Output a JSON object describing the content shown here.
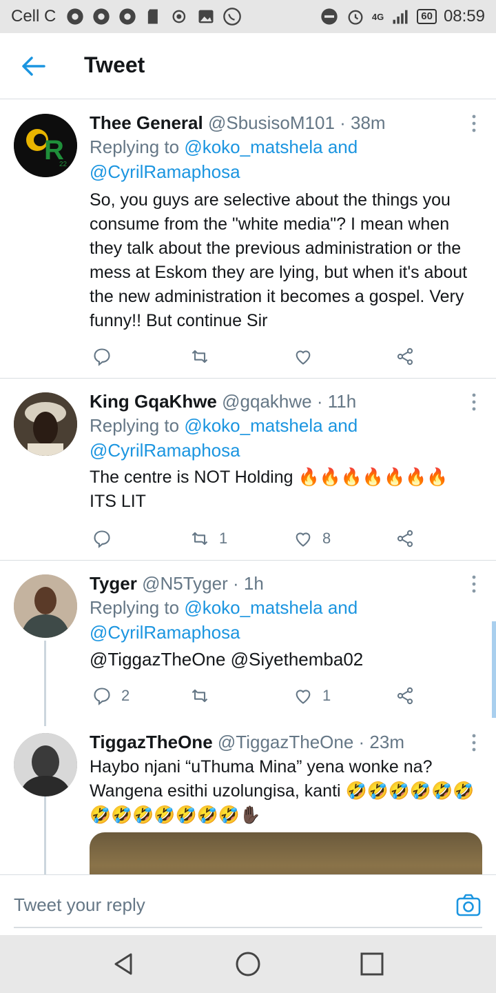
{
  "status_bar": {
    "carrier": "Cell C",
    "network": "4G",
    "battery": "60",
    "time": "08:59",
    "colors": {
      "bg": "#e6e6e6"
    }
  },
  "header": {
    "title": "Tweet"
  },
  "tweets": [
    {
      "name": "Thee General",
      "handle": "@SbusisoM101 · 38m",
      "replying_prefix": "Replying to ",
      "replying_user1": "@koko_matshela",
      "replying_and": " and",
      "replying_user2": "@CyrilRamaphosa",
      "text": "So, you guys are selective about the things you consume from the \"white media\"? I mean when they talk about the previous administration or the mess at Eskom they are lying, but when it's about the new administration it becomes a gospel. Very funny!! But continue Sir",
      "avatar_text": "R",
      "avatar_sub": "22",
      "replies": "",
      "retweets": "",
      "likes": ""
    },
    {
      "name": "King GqaKhwe",
      "handle": "@gqakhwe · 11h",
      "replying_prefix": "Replying to ",
      "replying_user1": "@koko_matshela",
      "replying_and": " and",
      "replying_user2": "@CyrilRamaphosa",
      "text": "The centre is NOT Holding 🔥🔥🔥🔥🔥🔥🔥 ITS LIT",
      "replies": "",
      "retweets": "1",
      "likes": "8"
    },
    {
      "name": "Tyger",
      "handle": "@N5Tyger · 1h",
      "replying_prefix": "Replying to ",
      "replying_user1": "@koko_matshela",
      "replying_and": " and",
      "replying_user2": "@CyrilRamaphosa",
      "mentions": "@TiggazTheOne @Siyethemba02",
      "replies": "2",
      "retweets": "",
      "likes": "1"
    },
    {
      "name": "TiggazTheOne",
      "handle": "@TiggazTheOne · 23m",
      "text": "Haybo njani “uThuma Mina” yena wonke na? Wangena esithi uzolungisa, kanti 🤣🤣🤣🤣🤣🤣🤣🤣🤣🤣🤣🤣🤣✋🏿"
    }
  ],
  "reply_bar": {
    "placeholder": "Tweet your reply"
  },
  "colors": {
    "link": "#1b95e0",
    "muted": "#657786",
    "text": "#14171a"
  }
}
